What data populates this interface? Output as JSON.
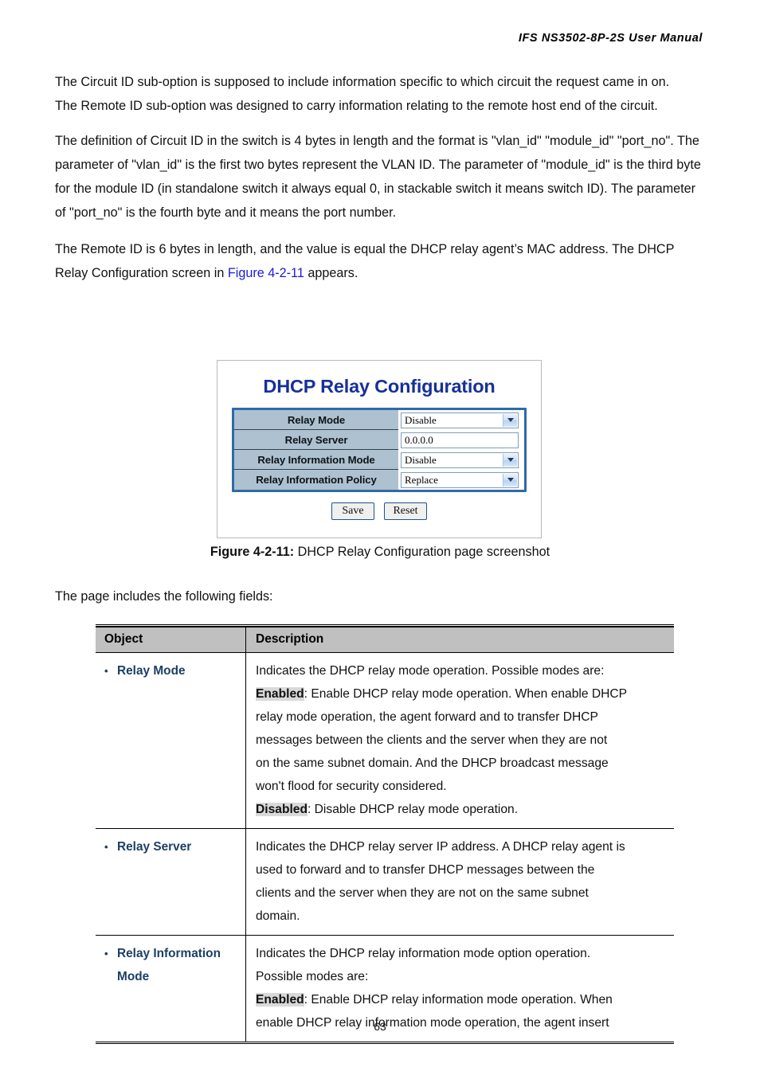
{
  "header": {
    "title": "IFS  NS3502-8P-2S  User  Manual"
  },
  "paragraphs": {
    "p1_line1": "The Circuit ID sub-option is supposed to include information specific to which circuit the request came in on.",
    "p1_line2": "The Remote ID sub-option was designed to carry information relating to the remote host end of the circuit.",
    "p2": "The definition of Circuit ID in the switch is 4 bytes in length and the format is \"vlan_id\" \"module_id\" \"port_no\". The parameter of \"vlan_id\" is the first two bytes represent the VLAN ID. The parameter of \"module_id\" is the third byte for the module ID (in standalone switch it always equal 0, in stackable switch it means switch ID). The parameter of \"port_no\" is the fourth byte and it means the port number.",
    "p3_before_link": "The Remote ID is 6 bytes in length, and the value is equal the DHCP relay agent’s MAC address. The DHCP Relay Configuration screen in ",
    "p3_link": "Figure 4-2-11",
    "p3_after_link": " appears."
  },
  "figure": {
    "title": "DHCP Relay Configuration",
    "rows": [
      {
        "label": "Relay Mode",
        "control": "select",
        "value": "Disable"
      },
      {
        "label": "Relay Server",
        "control": "text",
        "value": "0.0.0.0"
      },
      {
        "label": "Relay Information Mode",
        "control": "select",
        "value": "Disable"
      },
      {
        "label": "Relay Information Policy",
        "control": "select",
        "value": "Replace"
      }
    ],
    "save_label": "Save",
    "reset_label": "Reset",
    "caption_bold": "Figure 4-2-11:",
    "caption_text": " DHCP Relay Configuration page screenshot",
    "title_color": "#16309a",
    "label_bg": "#aec1d0",
    "border_color": "#2f6aa8"
  },
  "lead_in": "The page includes the following fields:",
  "field_table": {
    "headers": {
      "object": "Object",
      "description": "Description"
    },
    "rows": [
      {
        "object_line1": "Relay Mode",
        "object_line2": "",
        "lines": [
          {
            "plain": "Indicates the DHCP relay mode operation. Possible modes are:"
          },
          {
            "highlight": "Enabled",
            "plain": ": Enable DHCP relay mode operation. When enable DHCP"
          },
          {
            "plain": "relay mode operation, the agent forward and to transfer DHCP"
          },
          {
            "plain": "messages between the clients and the server when they are not"
          },
          {
            "plain": "on the same subnet domain. And the DHCP broadcast message"
          },
          {
            "plain": "won't flood for security considered."
          },
          {
            "highlight": "Disabled",
            "plain": ": Disable DHCP relay mode operation."
          }
        ]
      },
      {
        "object_line1": "Relay Server",
        "object_line2": "",
        "lines": [
          {
            "plain": "Indicates the DHCP relay server IP address. A DHCP relay agent is"
          },
          {
            "plain": "used to forward and to transfer DHCP messages between the"
          },
          {
            "plain": "clients and the server when they are not on the same subnet"
          },
          {
            "plain": "domain."
          }
        ]
      },
      {
        "object_line1": "Relay Information",
        "object_line2": "Mode",
        "lines": [
          {
            "plain": "Indicates the DHCP relay information mode option operation."
          },
          {
            "plain": "Possible modes are:"
          },
          {
            "highlight": "Enabled",
            "plain": ": Enable DHCP relay information mode operation. When"
          },
          {
            "plain": "enable DHCP relay information mode operation, the agent insert"
          }
        ]
      }
    ],
    "header_bg": "#c0c0c0",
    "object_color": "#1d3f66",
    "highlight_bg": "#d9d9d9"
  },
  "footer": {
    "page_number": "63"
  }
}
